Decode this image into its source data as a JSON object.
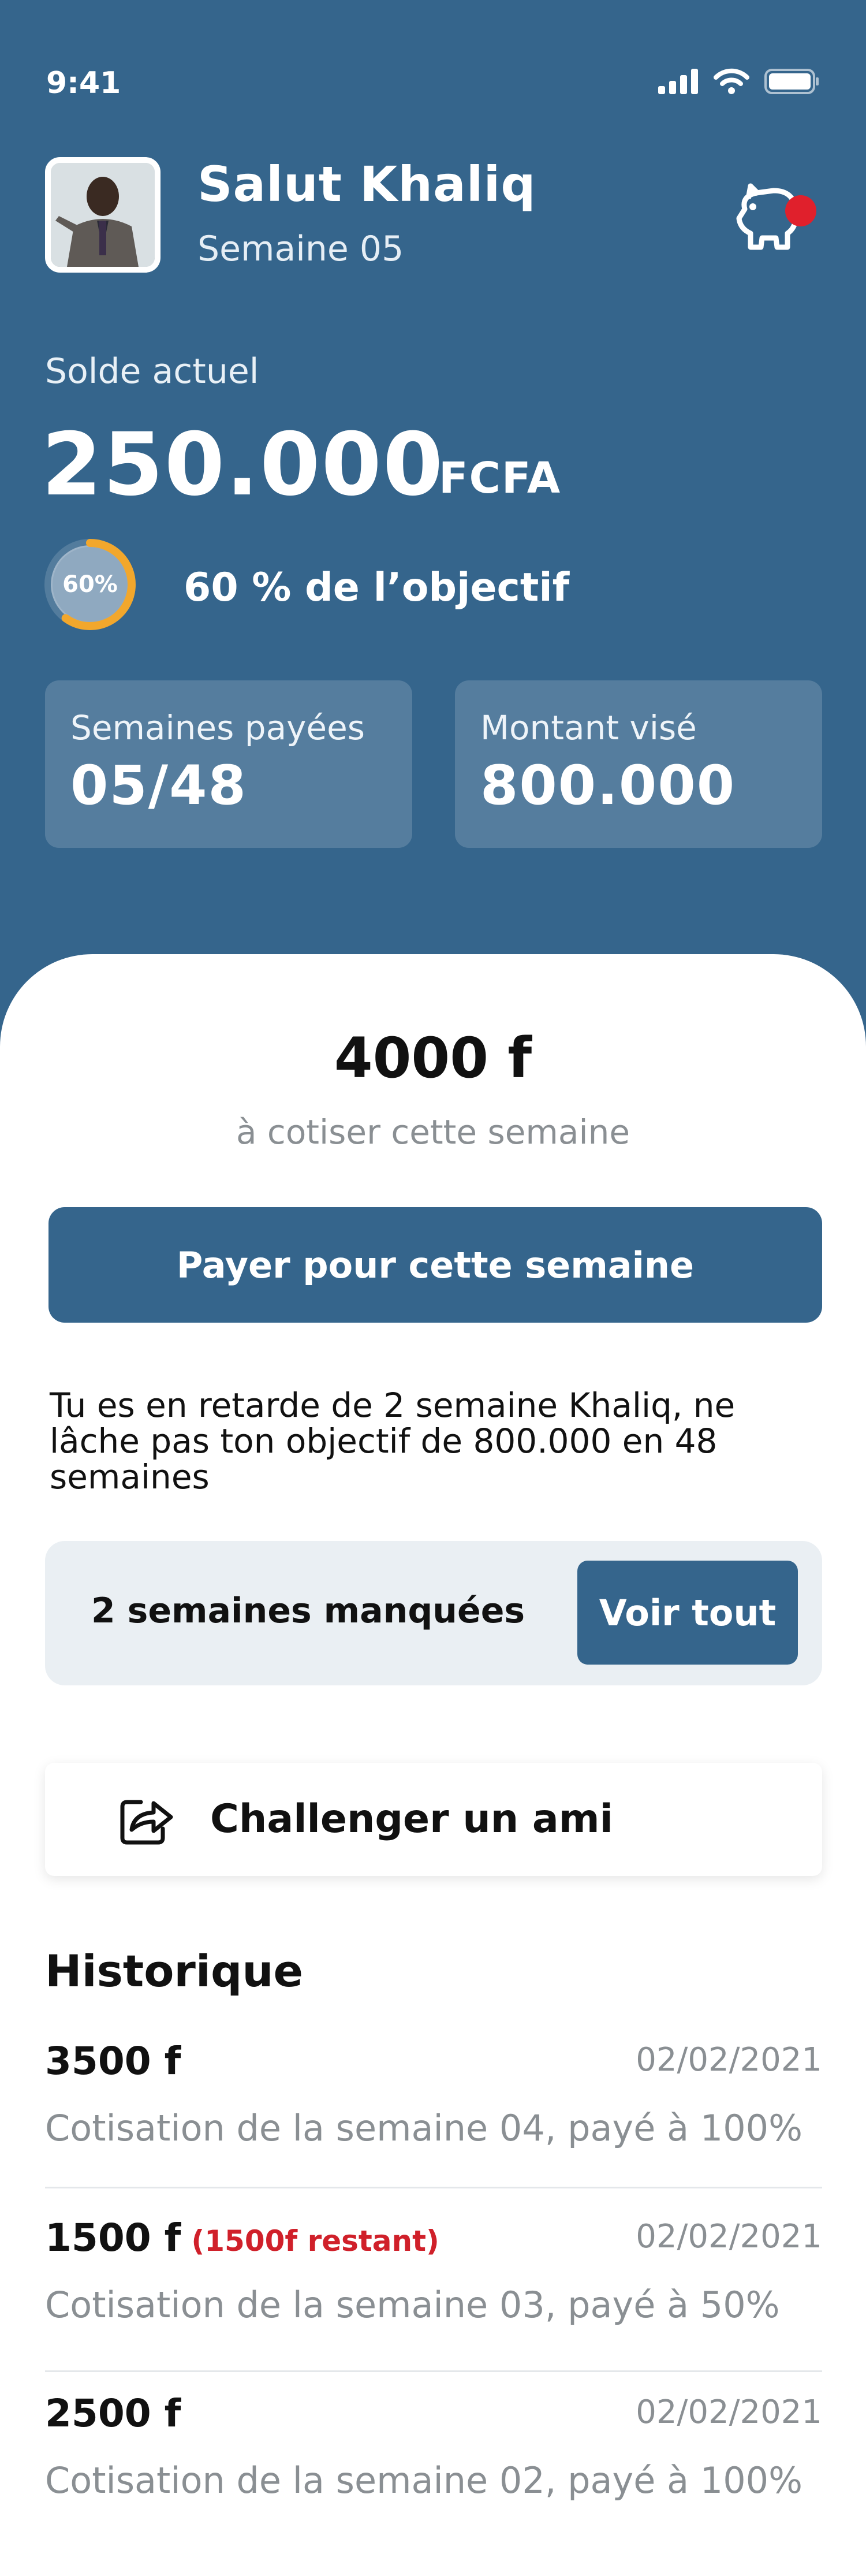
{
  "status_bar": {
    "time": "9:41"
  },
  "header": {
    "greeting": "Salut Khaliq",
    "week": "Semaine 05",
    "balance_label": "Solde actuel",
    "balance_value": "250.000",
    "balance_unit": "FCFA",
    "progress_percent": 60,
    "progress_label": "60%",
    "objective_text": "60 % de l’objectif"
  },
  "stats": {
    "weeks_paid_label": "Semaines payées",
    "weeks_paid_value": "05/48",
    "target_label": "Montant visé",
    "target_value": "800.000"
  },
  "contribution": {
    "amount": "4000 f",
    "subtitle": "à cotiser cette semaine",
    "pay_label": "Payer pour cette semaine"
  },
  "late_message": "Tu es en retarde de 2 semaine Khaliq, ne lâche pas ton objectif de 800.000 en 48 semaines",
  "missed": {
    "text": "2 semaines manquées",
    "see_all_label": "Voir tout"
  },
  "challenge": {
    "label": "Challenger un ami"
  },
  "history": {
    "title": "Historique",
    "items": [
      {
        "amount": "3500 f",
        "remaining": "",
        "date": "02/02/2021",
        "description": "Cotisation de la semaine 04, payé à 100%"
      },
      {
        "amount": "1500 f",
        "remaining": "(1500f restant)",
        "date": "02/02/2021",
        "description": "Cotisation de la semaine 03, payé à 50%"
      },
      {
        "amount": "2500 f",
        "remaining": "",
        "date": "02/02/2021",
        "description": "Cotisation de la semaine 02, payé à 100%"
      }
    ]
  },
  "colors": {
    "primary": "#35658c",
    "accent_ring": "#f2a72c",
    "alert": "#e0202c",
    "muted_text": "#8a8f93"
  },
  "icons": [
    "signal-icon",
    "wifi-icon",
    "battery-icon",
    "piggy-bank-icon",
    "share-icon"
  ]
}
